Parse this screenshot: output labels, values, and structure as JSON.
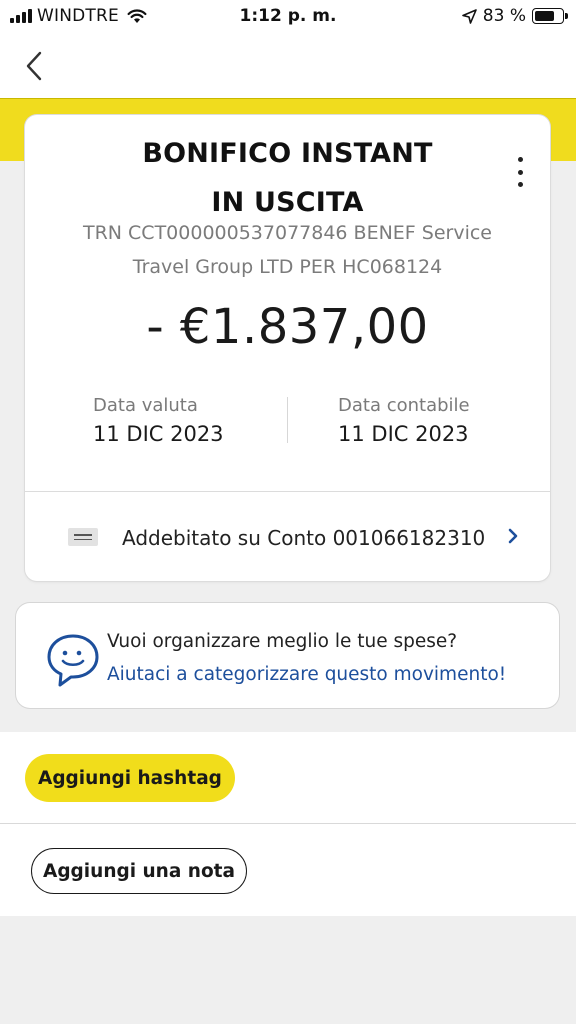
{
  "status_bar": {
    "carrier": "WINDTRE",
    "time": "1:12 p. m.",
    "battery_percent": "83 %",
    "battery_level": 0.83
  },
  "nav": {
    "back_icon": "chevron-left-icon"
  },
  "transaction": {
    "title_line1": "BONIFICO INSTANT",
    "title_line2": "IN USCITA",
    "description_line1": "TRN CCT000000537077846 BENEF Service",
    "description_line2": "Travel Group LTD PER HC068124",
    "amount": "- €1.837,00",
    "value_date_label": "Data valuta",
    "value_date": "11 DIC 2023",
    "accounting_date_label": "Data contabile",
    "accounting_date": "11 DIC 2023",
    "account_text": "Addebitato su Conto 001066182310"
  },
  "tip": {
    "question": "Vuoi organizzare meglio le tue spese?",
    "link": "Aiutaci a categorizzare questo movimento!"
  },
  "actions": {
    "hashtag_label": "Aggiungi hashtag",
    "note_label": "Aggiungi una nota"
  },
  "colors": {
    "brand_yellow": "#f0dc1e",
    "link_blue": "#1d4f9c",
    "chevron_blue": "#1d4f9c"
  }
}
